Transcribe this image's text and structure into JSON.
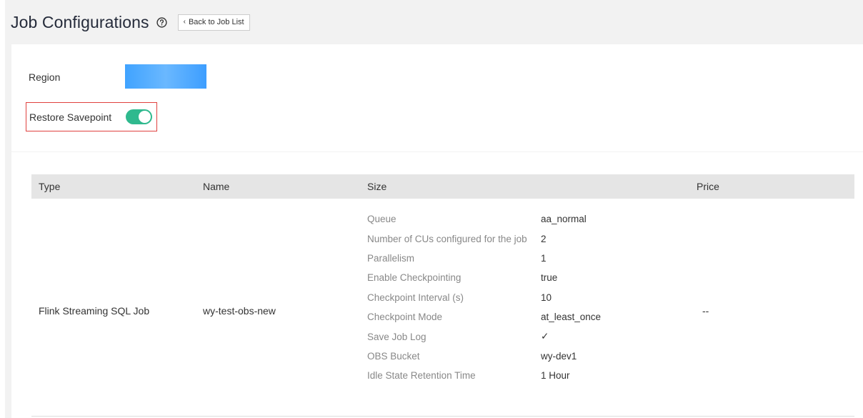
{
  "header": {
    "title": "Job Configurations",
    "help_icon": "question-circle-icon",
    "back_label": "Back to Job List",
    "back_icon": "chevron-left-icon"
  },
  "config": {
    "region_label": "Region",
    "region_value": "",
    "savepoint_label": "Restore Savepoint",
    "savepoint_enabled": true
  },
  "table": {
    "columns": [
      "Type",
      "Name",
      "Size",
      "Price"
    ],
    "row": {
      "type": "Flink Streaming SQL Job",
      "name": "wy-test-obs-new",
      "price": "--",
      "size": [
        {
          "key": "Queue",
          "value": "aa_normal"
        },
        {
          "key": "Number of CUs configured for the job",
          "value": "2"
        },
        {
          "key": "Parallelism",
          "value": "1"
        },
        {
          "key": "Enable Checkpointing",
          "value": "true"
        },
        {
          "key": "Checkpoint Interval (s)",
          "value": "10"
        },
        {
          "key": "Checkpoint Mode",
          "value": "at_least_once"
        },
        {
          "key": "Save Job Log",
          "value": "✓"
        },
        {
          "key": "OBS Bucket",
          "value": "wy-dev1"
        },
        {
          "key": "Idle State Retention Time",
          "value": "1 Hour"
        }
      ]
    }
  },
  "colors": {
    "toggle_on": "#2fb98e",
    "highlight_border": "#e0413f",
    "region_blue": "#40a3ff"
  }
}
